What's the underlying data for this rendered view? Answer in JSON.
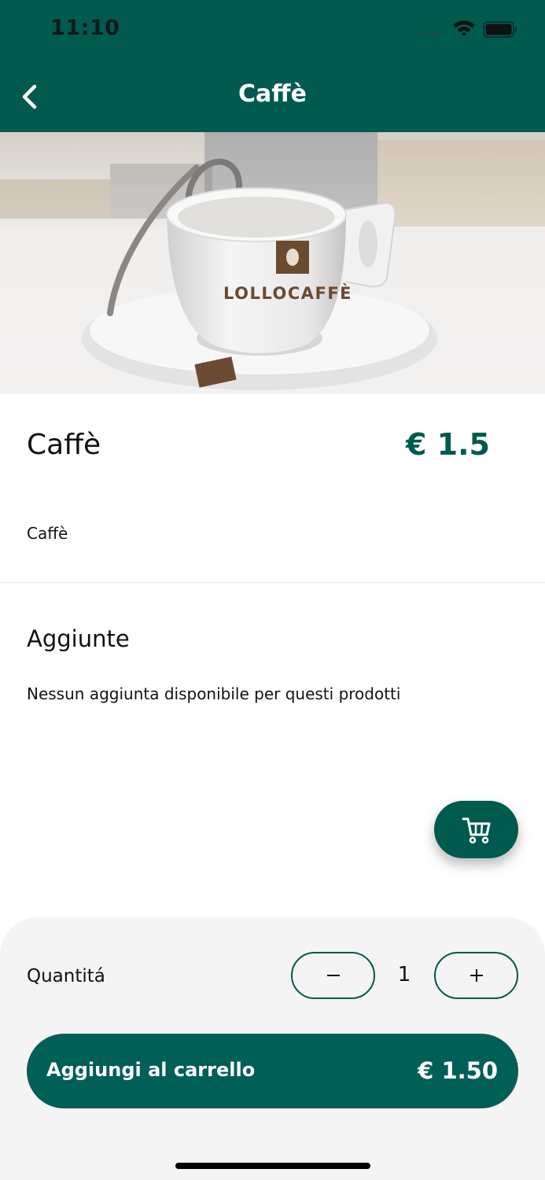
{
  "status_bar": {
    "time": "11:10"
  },
  "nav": {
    "title": "Caffè",
    "back_icon": "chevron-left-icon"
  },
  "hero": {
    "cup_brand": "LOLLOCAFFÈ"
  },
  "product": {
    "name": "Caffè",
    "price": "€ 1.5",
    "description": "Caffè"
  },
  "addons": {
    "title": "Aggiunte",
    "empty_message": "Nessun aggiunta disponibile per questi prodotti"
  },
  "cart_fab": {
    "icon": "cart-icon"
  },
  "quantity": {
    "label": "Quantitá",
    "value": "1",
    "minus_icon": "minus-icon",
    "plus_icon": "plus-icon"
  },
  "add_to_cart": {
    "label": "Aggiungi al carrello",
    "total": "€ 1.50"
  },
  "colors": {
    "primary": "#005a4e",
    "button": "#005f57",
    "sheet_bg": "#f4f4f4"
  }
}
